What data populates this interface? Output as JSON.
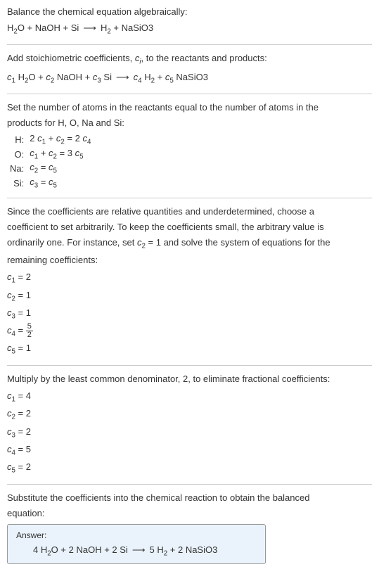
{
  "title": {
    "line1": "Balance the chemical equation algebraically:",
    "equation_parts": {
      "r1": "H",
      "r1sub": "2",
      "r1suffix": "O",
      "plus1": " + ",
      "r2": "NaOH",
      "plus2": " + ",
      "r3": "Si",
      "arrow": "⟶",
      "p1": "H",
      "p1sub": "2",
      "plus3": " + ",
      "p2": "NaSiO3"
    }
  },
  "step1": {
    "text": "Add stoichiometric coefficients, ",
    "ci": "c",
    "cisub": "i",
    "text2": ", to the reactants and products:",
    "eq": {
      "c1": "c",
      "c1sub": "1",
      "sp1": " ",
      "r1": "H",
      "r1sub": "2",
      "r1suffix": "O",
      "plus1": " + ",
      "c2": "c",
      "c2sub": "2",
      "sp2": " ",
      "r2": "NaOH",
      "plus2": " + ",
      "c3": "c",
      "c3sub": "3",
      "sp3": " ",
      "r3": "Si",
      "arrow": "⟶",
      "c4": "c",
      "c4sub": "4",
      "sp4": " ",
      "p1": "H",
      "p1sub": "2",
      "plus3": " + ",
      "c5": "c",
      "c5sub": "5",
      "sp5": " ",
      "p2": "NaSiO3"
    }
  },
  "step2": {
    "text1": "Set the number of atoms in the reactants equal to the number of atoms in the",
    "text2": "products for H, O, Na and Si:",
    "rows": [
      {
        "label": "H:",
        "lhs_a": "2 ",
        "c1": "c",
        "c1s": "1",
        "plus": " + ",
        "c2": "c",
        "c2s": "2",
        "eq": " = 2 ",
        "c3": "c",
        "c3s": "4"
      },
      {
        "label": "O:",
        "lhs_a": "",
        "c1": "c",
        "c1s": "1",
        "plus": " + ",
        "c2": "c",
        "c2s": "2",
        "eq": " = 3 ",
        "c3": "c",
        "c3s": "5"
      },
      {
        "label": "Na:",
        "lhs_a": "",
        "c1": "c",
        "c1s": "2",
        "plus": "",
        "c2": "",
        "c2s": "",
        "eq": " = ",
        "c3": "c",
        "c3s": "5"
      },
      {
        "label": "Si:",
        "lhs_a": "",
        "c1": "c",
        "c1s": "3",
        "plus": "",
        "c2": "",
        "c2s": "",
        "eq": " = ",
        "c3": "c",
        "c3s": "5"
      }
    ]
  },
  "step3": {
    "p1": "Since the coefficients are relative quantities and underdetermined, choose a",
    "p2": "coefficient to set arbitrarily. To keep the coefficients small, the arbitrary value is",
    "p3a": "ordinarily one. For instance, set ",
    "p3c": "c",
    "p3cs": "2",
    "p3eq": " = 1",
    "p3b": " and solve the system of equations for the",
    "p4": "remaining coefficients:",
    "coeffs": [
      {
        "c": "c",
        "cs": "1",
        "val": " = 2",
        "frac": false
      },
      {
        "c": "c",
        "cs": "2",
        "val": " = 1",
        "frac": false
      },
      {
        "c": "c",
        "cs": "3",
        "val": " = 1",
        "frac": false
      },
      {
        "c": "c",
        "cs": "4",
        "val": " = ",
        "frac": true,
        "num": "5",
        "den": "2"
      },
      {
        "c": "c",
        "cs": "5",
        "val": " = 1",
        "frac": false
      }
    ]
  },
  "step4": {
    "text": "Multiply by the least common denominator, 2, to eliminate fractional coefficients:",
    "coeffs": [
      {
        "c": "c",
        "cs": "1",
        "val": " = 4"
      },
      {
        "c": "c",
        "cs": "2",
        "val": " = 2"
      },
      {
        "c": "c",
        "cs": "3",
        "val": " = 2"
      },
      {
        "c": "c",
        "cs": "4",
        "val": " = 5"
      },
      {
        "c": "c",
        "cs": "5",
        "val": " = 2"
      }
    ]
  },
  "step5": {
    "text1": "Substitute the coefficients into the chemical reaction to obtain the balanced",
    "text2": "equation:"
  },
  "answer": {
    "label": "Answer:",
    "eq": {
      "n1": "4 ",
      "r1": "H",
      "r1sub": "2",
      "r1suffix": "O",
      "plus1": " + ",
      "n2": "2 ",
      "r2": "NaOH",
      "plus2": " + ",
      "n3": "2 ",
      "r3": "Si",
      "arrow": "⟶",
      "n4": "5 ",
      "p1": "H",
      "p1sub": "2",
      "plus3": " + ",
      "n5": "2 ",
      "p2": "NaSiO3"
    }
  }
}
